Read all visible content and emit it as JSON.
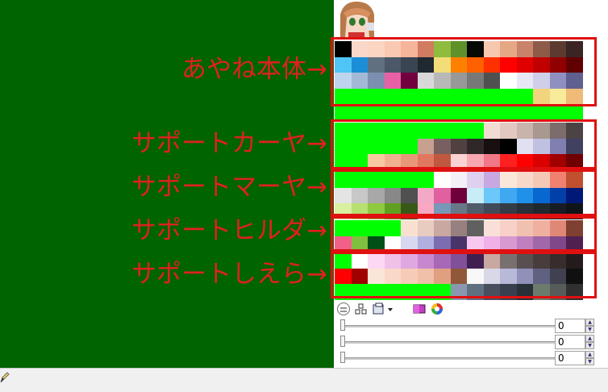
{
  "labels": [
    "あやね本体→",
    "サポートカーヤ→",
    "サポートマーヤ→",
    "サポートヒルダ→",
    "サポートしえら→"
  ],
  "sliders": [
    {
      "value": "0"
    },
    {
      "value": "0"
    },
    {
      "value": "0"
    }
  ],
  "toolbar_icons": [
    "collapse-toggle-icon",
    "grid-layout-icon",
    "palette-options-dropdown-icon",
    "gradient-palette-icon",
    "color-wheel-icon"
  ],
  "annotation_color": "#e02020",
  "canvas_background": "#006400",
  "palette": {
    "groups": [
      {
        "rows": [
          [
            [
              "#000000",
              1
            ],
            [
              "#fad7c9",
              1
            ],
            [
              "#fcd4c2",
              1
            ],
            [
              "#fac9b2",
              1
            ],
            [
              "#f4b59b",
              1
            ],
            [
              "#d17b60",
              1
            ],
            [
              "#8fbc3c",
              1
            ],
            [
              "#60902a",
              1
            ],
            [
              "#060a06",
              1
            ],
            [
              "#f6c8b0",
              1
            ],
            [
              "#e6a785",
              1
            ],
            [
              "#c8836a",
              1
            ],
            [
              "#8e5b48",
              1
            ],
            [
              "#5c3a30",
              1
            ],
            [
              "#3a2524",
              1
            ]
          ],
          [
            [
              "#4fc4f6",
              1
            ],
            [
              "#1c8ed8",
              1
            ],
            [
              "#607080",
              1
            ],
            [
              "#4c5868",
              1
            ],
            [
              "#3a4452",
              1
            ],
            [
              "#202830",
              1
            ],
            [
              "#f4dc78",
              1
            ],
            [
              "#ff8000",
              1
            ],
            [
              "#ff6000",
              1
            ],
            [
              "#ff3000",
              1
            ],
            [
              "#ff0000",
              1
            ],
            [
              "#e00000",
              1
            ],
            [
              "#c00000",
              1
            ],
            [
              "#900000",
              1
            ],
            [
              "#600000",
              1
            ]
          ],
          [
            [
              "#bdd4ec",
              1
            ],
            [
              "#a2b9d6",
              1
            ],
            [
              "#7c8fb0",
              1
            ],
            [
              "#e860a6",
              1
            ],
            [
              "#700040",
              1
            ],
            [
              "#d8d8d8",
              1
            ],
            [
              "#b8b8b8",
              1
            ],
            [
              "#989898",
              1
            ],
            [
              "#787878",
              1
            ],
            [
              "#505050",
              1
            ],
            [
              "#ffffff",
              1
            ],
            [
              "#e8e8f4",
              1
            ],
            [
              "#cfcfea",
              1
            ],
            [
              "#9090c0",
              1
            ],
            [
              "#606090",
              1
            ]
          ],
          [
            [
              "#00ff00",
              12
            ],
            [
              "#f2d47e",
              1
            ],
            [
              "#f8ec9a",
              1
            ],
            [
              "#f0ba78",
              1
            ]
          ]
        ]
      },
      {
        "rows": [
          [
            [
              "#00ff00",
              15
            ]
          ]
        ]
      },
      {
        "rows": [
          [
            [
              "#00ff00",
              9
            ],
            [
              "#f2dcd2",
              1
            ],
            [
              "#e2c8c0",
              1
            ],
            [
              "#c8b4ac",
              1
            ],
            [
              "#a89890",
              1
            ],
            [
              "#7c6c6c",
              1
            ],
            [
              "#4c4444",
              1
            ]
          ],
          [
            [
              "#00ff00",
              5
            ],
            [
              "#c8a090",
              1
            ],
            [
              "#786060",
              1
            ],
            [
              "#504040",
              1
            ],
            [
              "#302828",
              1
            ],
            [
              "#181010",
              1
            ],
            [
              "#000000",
              1
            ],
            [
              "#e0e0f0",
              1
            ],
            [
              "#c0c0e0",
              1
            ],
            [
              "#8080b0",
              1
            ],
            [
              "#404060",
              1
            ]
          ],
          [
            [
              "#00ff00",
              2
            ],
            [
              "#f8c8a0",
              1
            ],
            [
              "#f0b090",
              1
            ],
            [
              "#e89878",
              1
            ],
            [
              "#e07860",
              1
            ],
            [
              "#c05840",
              1
            ],
            [
              "#fad2d2",
              1
            ],
            [
              "#f8a8b0",
              1
            ],
            [
              "#f07888",
              1
            ],
            [
              "#ff2020",
              1
            ],
            [
              "#ff0000",
              1
            ],
            [
              "#d80000",
              1
            ],
            [
              "#a00000",
              1
            ],
            [
              "#700000",
              1
            ]
          ]
        ]
      },
      {
        "rows": [
          [
            [
              "#00ff00",
              6
            ],
            [
              "#ffffff",
              1
            ],
            [
              "#f4f0f8",
              1
            ],
            [
              "#e0d0f0",
              1
            ],
            [
              "#c8a8e0",
              1
            ],
            [
              "#fbe6da",
              1
            ],
            [
              "#f8d8c8",
              1
            ],
            [
              "#f4c8b4",
              1
            ],
            [
              "#f08070",
              1
            ],
            [
              "#c05030",
              1
            ]
          ],
          [
            [
              "#e4e4e4",
              1
            ],
            [
              "#c8c8c8",
              1
            ],
            [
              "#a8a8a8",
              1
            ],
            [
              "#888888",
              1
            ],
            [
              "#505050",
              1
            ],
            [
              "#f4a8c8",
              1
            ],
            [
              "#e060a0",
              1
            ],
            [
              "#70003c",
              1
            ],
            [
              "#c8ecf8",
              1
            ],
            [
              "#6cc8f8",
              1
            ],
            [
              "#40a8f0",
              1
            ],
            [
              "#2090e8",
              1
            ],
            [
              "#0868d0",
              1
            ],
            [
              "#0040a8",
              1
            ],
            [
              "#001878",
              1
            ]
          ],
          [
            [
              "#d8f0a0",
              1
            ],
            [
              "#b8e070",
              1
            ],
            [
              "#90c840",
              1
            ],
            [
              "#60a020",
              1
            ],
            [
              "#385818",
              1
            ],
            [
              "#f8a8c0",
              1
            ],
            [
              "#7898b8",
              1
            ],
            [
              "#687888",
              1
            ],
            [
              "#505c68",
              1
            ],
            [
              "#404a58",
              1
            ],
            [
              "#343c48",
              1
            ],
            [
              "#283038",
              1
            ],
            [
              "#202830",
              1
            ],
            [
              "#181c24",
              1
            ],
            [
              "#101418",
              1
            ]
          ]
        ]
      },
      {
        "rows": [
          [
            [
              "#00ff00",
              4
            ],
            [
              "#f8e0d0",
              1
            ],
            [
              "#e8ccc0",
              1
            ],
            [
              "#c8a8a0",
              1
            ],
            [
              "#988080",
              1
            ],
            [
              "#606060",
              1
            ],
            [
              "#f8e0d8",
              1
            ],
            [
              "#f8d0c8",
              1
            ],
            [
              "#f0c0b0",
              1
            ],
            [
              "#f0b0a0",
              1
            ],
            [
              "#e08878",
              1
            ],
            [
              "#804030",
              1
            ]
          ],
          [
            [
              "#f06088",
              1
            ],
            [
              "#80c040",
              1
            ],
            [
              "#005018",
              1
            ],
            [
              "#ffffff",
              1
            ],
            [
              "#d8d8f0",
              1
            ],
            [
              "#b0b0e0",
              1
            ],
            [
              "#7c6cb0",
              1
            ],
            [
              "#483468",
              1
            ],
            [
              "#f8c8f0",
              1
            ],
            [
              "#f0b0e8",
              1
            ],
            [
              "#d898d0",
              1
            ],
            [
              "#c080c0",
              1
            ],
            [
              "#a068a8",
              1
            ],
            [
              "#804888",
              1
            ],
            [
              "#502050",
              1
            ]
          ]
        ]
      },
      {
        "rows": [
          [
            [
              "#00ff00",
              1
            ],
            [
              "#ffffff",
              1
            ],
            [
              "#fcd8f4",
              1
            ],
            [
              "#f0c0e8",
              1
            ],
            [
              "#e0a8e0",
              1
            ],
            [
              "#c888d0",
              1
            ],
            [
              "#a868b8",
              1
            ],
            [
              "#805098",
              1
            ],
            [
              "#402050",
              1
            ],
            [
              "#c8a8a0",
              1
            ],
            [
              "#787070",
              1
            ],
            [
              "#585050",
              1
            ],
            [
              "#483c3c",
              1
            ],
            [
              "#382c2c",
              1
            ],
            [
              "#241c1c",
              1
            ]
          ],
          [
            [
              "#ff0000",
              1
            ],
            [
              "#a00000",
              1
            ],
            [
              "#fbe4d8",
              1
            ],
            [
              "#fad8c8",
              1
            ],
            [
              "#f6ccb8",
              1
            ],
            [
              "#f0c0a8",
              1
            ],
            [
              "#e0a080",
              1
            ],
            [
              "#905838",
              1
            ],
            [
              "#f8f8f8",
              1
            ],
            [
              "#d8d8e8",
              1
            ],
            [
              "#b8b8d8",
              1
            ],
            [
              "#9090b8",
              1
            ],
            [
              "#606080",
              1
            ],
            [
              "#404050",
              1
            ],
            [
              "#101010",
              1
            ]
          ],
          [
            [
              "#00ff00",
              7
            ],
            [
              "#8898b0",
              1
            ],
            [
              "#607080",
              1
            ],
            [
              "#485060",
              1
            ],
            [
              "#384050",
              1
            ],
            [
              "#283038",
              1
            ],
            [
              "#6c7c6c",
              1
            ],
            [
              "#585c58",
              1
            ],
            [
              "#303030",
              1
            ]
          ]
        ]
      }
    ]
  }
}
